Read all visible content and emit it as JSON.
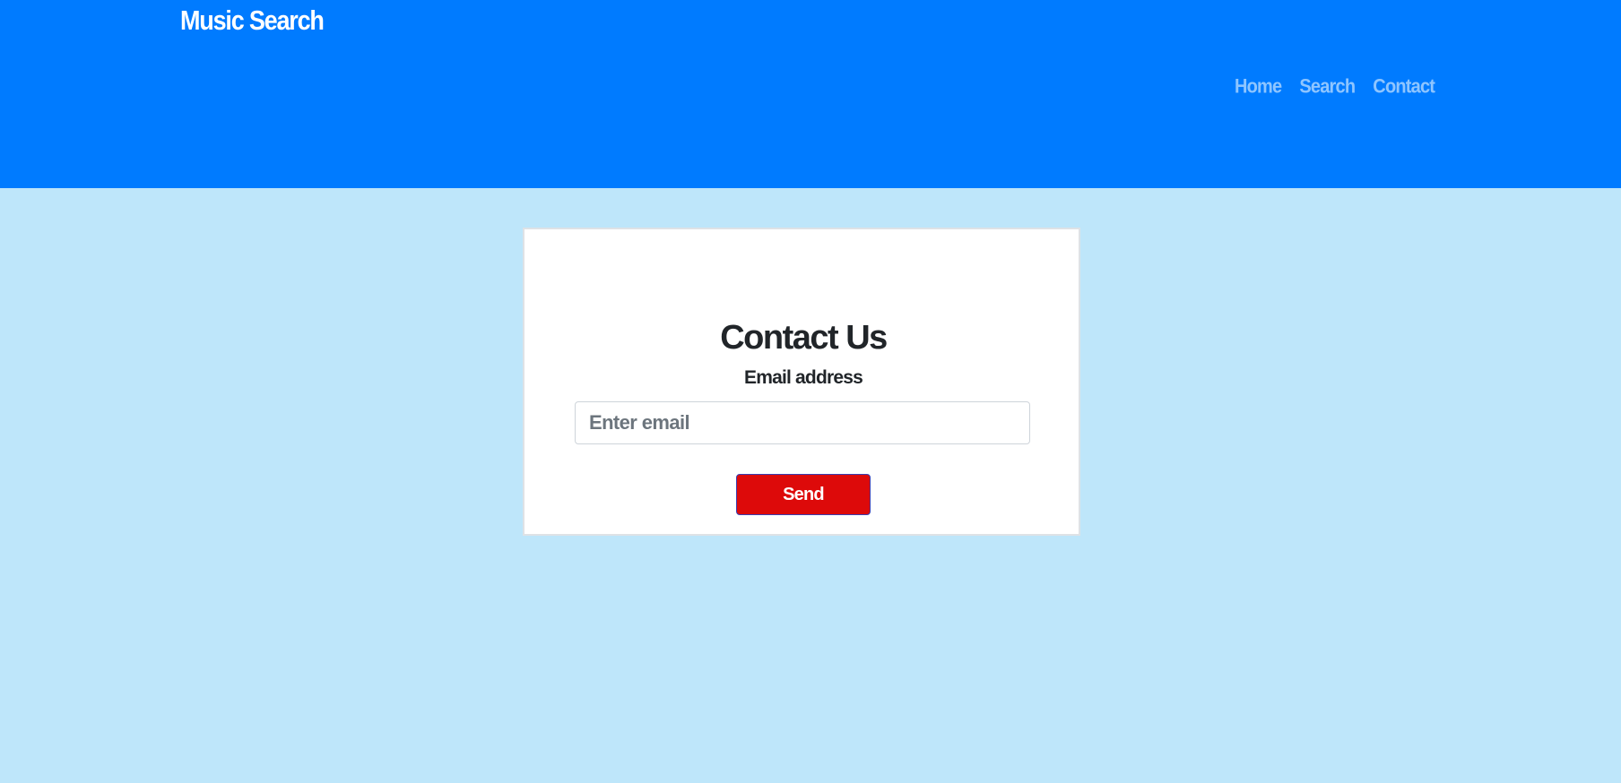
{
  "navbar": {
    "brand": "Music Search",
    "links": [
      {
        "label": "Home"
      },
      {
        "label": "Search"
      },
      {
        "label": "Contact"
      }
    ]
  },
  "contact_form": {
    "title": "Contact Us",
    "email_label": "Email address",
    "email_placeholder": "Enter email",
    "email_value": "",
    "send_label": "Send"
  },
  "colors": {
    "navbar_background": "#007bff",
    "brand_text": "#ffffff",
    "nav_link_text": "#8ec5ff",
    "page_background": "#bee6fa",
    "heading_text": "#212529",
    "send_button_background": "#dd0a0a"
  }
}
